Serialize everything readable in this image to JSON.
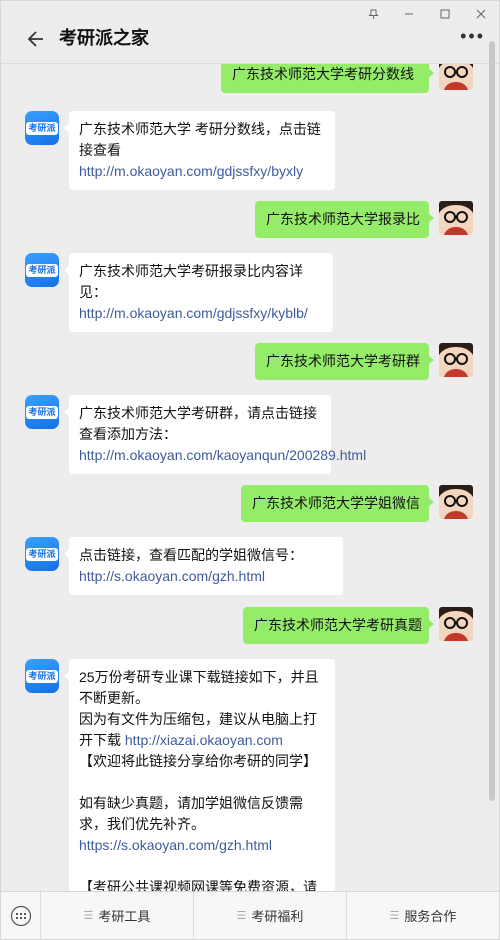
{
  "header": {
    "title": "考研派之家"
  },
  "bot_avatar_text": "考研派",
  "messages": [
    {
      "from": "user",
      "text": "广东技术师范大学考研分数线"
    },
    {
      "from": "bot",
      "parts": [
        {
          "text": "广东技术师范大学 考研分数线，点击链接查看 "
        },
        {
          "link": "http://m.okaoyan.com/gdjssfxy/byxly"
        }
      ]
    },
    {
      "from": "user",
      "text": "广东技术师范大学报录比"
    },
    {
      "from": "bot",
      "parts": [
        {
          "text": "广东技术师范大学考研报录比内容详见："
        },
        {
          "link": "http://m.okaoyan.com/gdjssfxy/kyblb/"
        }
      ]
    },
    {
      "from": "user",
      "text": "广东技术师范大学考研群"
    },
    {
      "from": "bot",
      "parts": [
        {
          "text": "广东技术师范大学考研群，请点击链接查看添加方法："
        },
        {
          "link": "http://m.okaoyan.com/kaoyanqun/200289.html"
        }
      ]
    },
    {
      "from": "user",
      "text": "广东技术师范大学学姐微信"
    },
    {
      "from": "bot",
      "parts": [
        {
          "text": "点击链接，查看匹配的学姐微信号："
        },
        {
          "link": "http://s.okaoyan.com/gzh.html"
        }
      ]
    },
    {
      "from": "user",
      "text": "广东技术师范大学考研真题"
    },
    {
      "from": "bot",
      "parts": [
        {
          "text": "25万份考研专业课下载链接如下，并且不断更新。"
        },
        {
          "break": true
        },
        {
          "text": "因为有文件为压缩包，建议从电脑上打开下载 "
        },
        {
          "link": "http://xiazai.okaoyan.com"
        },
        {
          "break": true
        },
        {
          "text": "【欢迎将此链接分享给你考研的同学】"
        },
        {
          "blank": true
        },
        {
          "text": "如有缺少真题，请加学姐微信反馈需求，我们优先补齐。"
        },
        {
          "link": "https://s.okaoyan.com/gzh.html"
        },
        {
          "blank": true
        },
        {
          "text": "【考研公共课视频网课等免费资源，请搜索关注“考研资料员”免费领取】"
        }
      ]
    }
  ],
  "menu": {
    "items": [
      "考研工具",
      "考研福利",
      "服务合作"
    ]
  },
  "colors": {
    "bubble_out": "#95ec69",
    "link": "#3d5b9c",
    "bot_avatar": "#1a7df0"
  }
}
